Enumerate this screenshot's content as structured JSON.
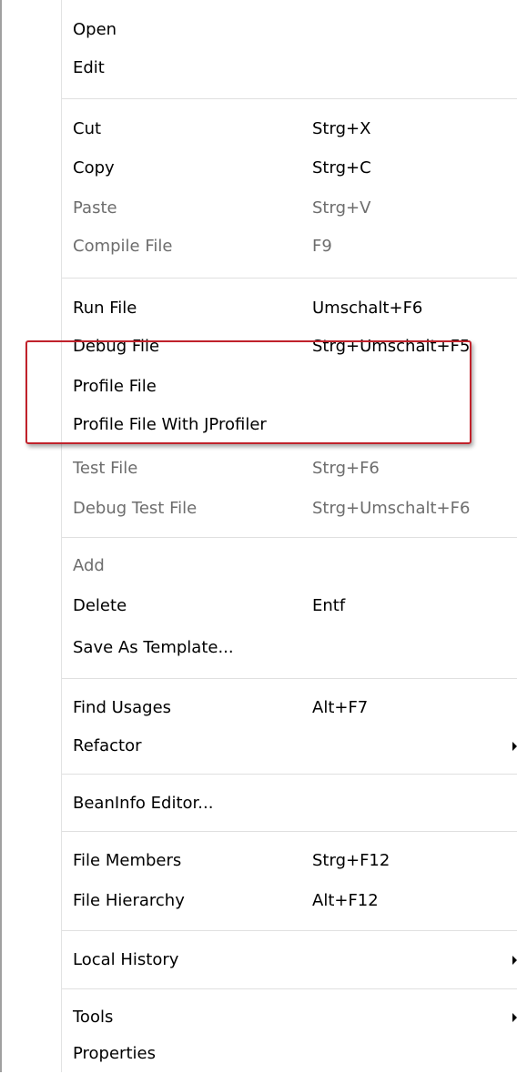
{
  "menu": {
    "items": [
      {
        "label": "Open",
        "shortcut": "",
        "enabled": true,
        "submenu": false
      },
      {
        "label": "Edit",
        "shortcut": "",
        "enabled": true,
        "submenu": false
      },
      {
        "label": "Cut",
        "shortcut": "Strg+X",
        "enabled": true,
        "submenu": false
      },
      {
        "label": "Copy",
        "shortcut": "Strg+C",
        "enabled": true,
        "submenu": false
      },
      {
        "label": "Paste",
        "shortcut": "Strg+V",
        "enabled": false,
        "submenu": false
      },
      {
        "label": "Compile File",
        "shortcut": "F9",
        "enabled": false,
        "submenu": false
      },
      {
        "label": "Run File",
        "shortcut": "Umschalt+F6",
        "enabled": true,
        "submenu": false
      },
      {
        "label": "Debug File",
        "shortcut": "Strg+Umschalt+F5",
        "enabled": true,
        "submenu": false
      },
      {
        "label": "Profile File",
        "shortcut": "",
        "enabled": true,
        "submenu": false
      },
      {
        "label": "Profile File With JProfiler",
        "shortcut": "",
        "enabled": true,
        "submenu": false
      },
      {
        "label": "Test File",
        "shortcut": "Strg+F6",
        "enabled": false,
        "submenu": false
      },
      {
        "label": "Debug Test File",
        "shortcut": "Strg+Umschalt+F6",
        "enabled": false,
        "submenu": false
      },
      {
        "label": "Add",
        "shortcut": "",
        "enabled": false,
        "submenu": false
      },
      {
        "label": "Delete",
        "shortcut": "Entf",
        "enabled": true,
        "submenu": false
      },
      {
        "label": "Save As Template...",
        "shortcut": "",
        "enabled": true,
        "submenu": false
      },
      {
        "label": "Find Usages",
        "shortcut": "Alt+F7",
        "enabled": true,
        "submenu": false
      },
      {
        "label": "Refactor",
        "shortcut": "",
        "enabled": true,
        "submenu": true
      },
      {
        "label": "BeanInfo Editor...",
        "shortcut": "",
        "enabled": true,
        "submenu": false
      },
      {
        "label": "File Members",
        "shortcut": "Strg+F12",
        "enabled": true,
        "submenu": false
      },
      {
        "label": "File Hierarchy",
        "shortcut": "Alt+F12",
        "enabled": true,
        "submenu": false
      },
      {
        "label": "Local History",
        "shortcut": "",
        "enabled": true,
        "submenu": true
      },
      {
        "label": "Tools",
        "shortcut": "",
        "enabled": true,
        "submenu": true
      },
      {
        "label": "Properties",
        "shortcut": "",
        "enabled": true,
        "submenu": false
      }
    ]
  },
  "colors": {
    "text": "#000000",
    "disabled_text": "#6d6d6d",
    "highlight_border": "#c0222b"
  }
}
